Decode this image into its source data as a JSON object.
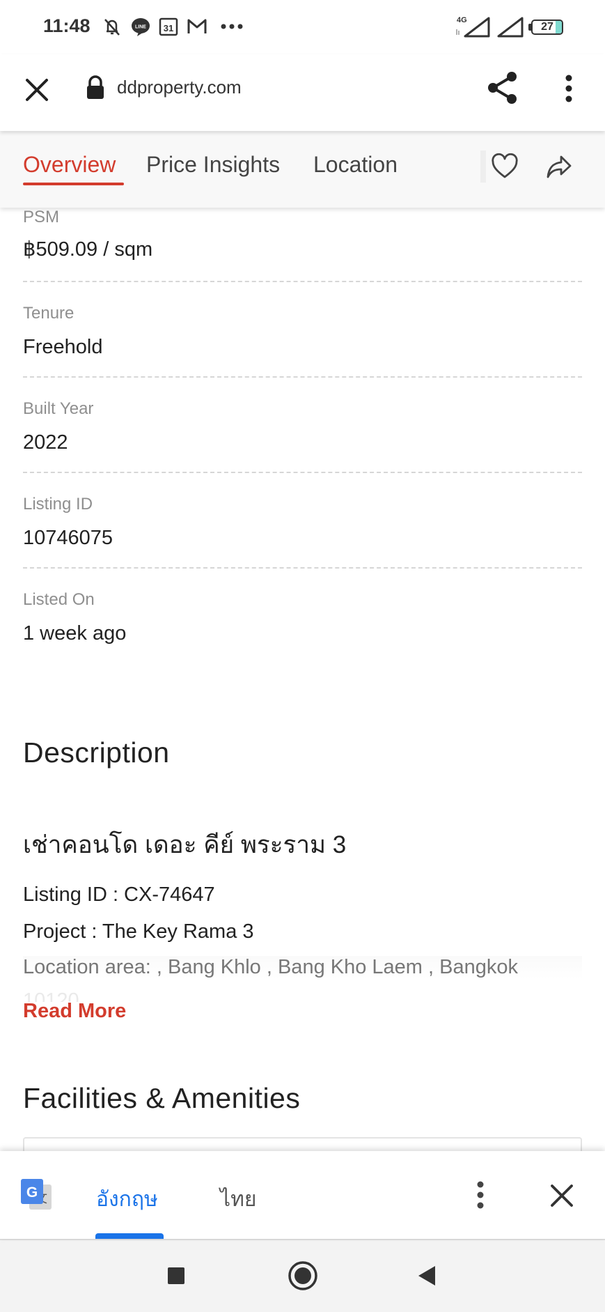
{
  "status_bar": {
    "time": "11:48",
    "icons": [
      "mute-icon",
      "line-icon",
      "calendar-icon",
      "gmail-icon",
      "more-notifications-icon"
    ],
    "calendar_day": "31",
    "network": "4G",
    "battery_level": "27"
  },
  "browser": {
    "url": "ddproperty.com"
  },
  "tabs": [
    {
      "label": "Overview",
      "active": true
    },
    {
      "label": "Price Insights",
      "active": false
    },
    {
      "label": "Location",
      "active": false
    }
  ],
  "details": [
    {
      "label": "PSM",
      "value": "฿509.09 / sqm"
    },
    {
      "label": "Tenure",
      "value": "Freehold"
    },
    {
      "label": "Built Year",
      "value": "2022"
    },
    {
      "label": "Listing ID",
      "value": "10746075"
    },
    {
      "label": "Listed On",
      "value": "1 week ago"
    }
  ],
  "description": {
    "title": "Description",
    "heading": "เช่าคอนโด เดอะ คีย์ พระราม 3",
    "lines": [
      "Listing ID : CX-74647",
      "Project : The Key Rama 3",
      "Location area: , Bang Khlo , Bang Kho Laem , Bangkok"
    ],
    "cutoff_text": "10120",
    "read_more": "Read More"
  },
  "facilities": {
    "title": "Facilities & Amenities"
  },
  "translate": {
    "languages": [
      {
        "label": "อังกฤษ",
        "active": true
      },
      {
        "label": "ไทย",
        "active": false
      }
    ]
  },
  "colors": {
    "accent_red": "#d33c2d",
    "google_blue": "#1a73e8"
  }
}
